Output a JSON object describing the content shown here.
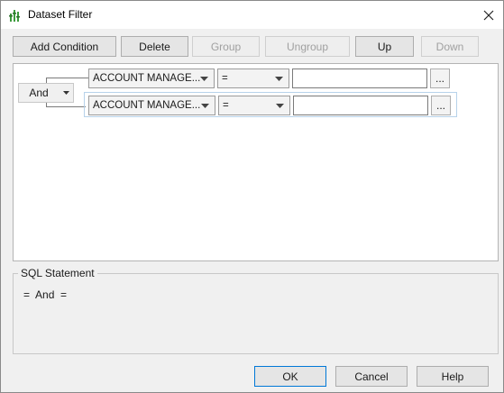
{
  "window": {
    "title": "Dataset Filter"
  },
  "toolbar": {
    "add_condition": "Add Condition",
    "delete": "Delete",
    "group": "Group",
    "ungroup": "Ungroup",
    "up": "Up",
    "down": "Down"
  },
  "logic": {
    "operator": "And"
  },
  "conditions": [
    {
      "field": "ACCOUNT MANAGE...",
      "operator": "=",
      "value": "",
      "browse": "..."
    },
    {
      "field": "ACCOUNT MANAGE...",
      "operator": "=",
      "value": "",
      "browse": "..."
    }
  ],
  "sql": {
    "label": "SQL Statement",
    "text": "=  And  ="
  },
  "footer": {
    "ok": "OK",
    "cancel": "Cancel",
    "help": "Help"
  },
  "icons": {
    "app": "filter-bars-icon",
    "close": "close-icon",
    "dropdown": "triangle-down-icon"
  }
}
